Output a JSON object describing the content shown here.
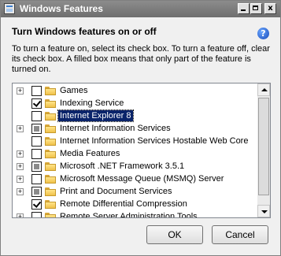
{
  "window": {
    "title": "Windows Features",
    "controls": {
      "minimize": "",
      "maximize": "",
      "close": "x"
    }
  },
  "heading": "Turn Windows features on or off",
  "help_icon": "?",
  "description": "To turn a feature on, select its check box. To turn a feature off, clear its check box. A filled box means that only part of the feature is turned on.",
  "features": [
    {
      "label": "Games",
      "expandable": true,
      "state": "unchecked"
    },
    {
      "label": "Indexing Service",
      "expandable": false,
      "state": "checked"
    },
    {
      "label": "Internet Explorer 8",
      "expandable": false,
      "state": "unchecked",
      "selected": true
    },
    {
      "label": "Internet Information Services",
      "expandable": true,
      "state": "partial"
    },
    {
      "label": "Internet Information Services Hostable Web Core",
      "expandable": false,
      "state": "unchecked"
    },
    {
      "label": "Media Features",
      "expandable": true,
      "state": "unchecked"
    },
    {
      "label": "Microsoft .NET Framework 3.5.1",
      "expandable": true,
      "state": "partial"
    },
    {
      "label": "Microsoft Message Queue (MSMQ) Server",
      "expandable": true,
      "state": "unchecked"
    },
    {
      "label": "Print and Document Services",
      "expandable": true,
      "state": "partial"
    },
    {
      "label": "Remote Differential Compression",
      "expandable": false,
      "state": "checked"
    },
    {
      "label": "Remote Server Administration Tools",
      "expandable": true,
      "state": "unchecked"
    }
  ],
  "expand_glyph": "+",
  "buttons": {
    "ok": "OK",
    "cancel": "Cancel"
  }
}
